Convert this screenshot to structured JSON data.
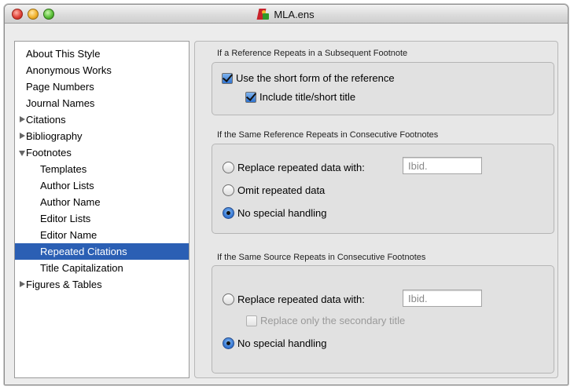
{
  "window": {
    "title": "MLA.ens"
  },
  "sidebar": {
    "items": [
      {
        "label": "About This Style",
        "expander": "none",
        "selected": false
      },
      {
        "label": "Anonymous Works",
        "expander": "none",
        "selected": false
      },
      {
        "label": "Page Numbers",
        "expander": "none",
        "selected": false
      },
      {
        "label": "Journal Names",
        "expander": "none",
        "selected": false
      },
      {
        "label": "Citations",
        "expander": "collapsed",
        "selected": false
      },
      {
        "label": "Bibliography",
        "expander": "collapsed",
        "selected": false
      },
      {
        "label": "Footnotes",
        "expander": "expanded",
        "selected": false
      },
      {
        "label": "Templates",
        "expander": "none",
        "selected": false
      },
      {
        "label": "Author Lists",
        "expander": "none",
        "selected": false
      },
      {
        "label": "Author Name",
        "expander": "none",
        "selected": false
      },
      {
        "label": "Editor Lists",
        "expander": "none",
        "selected": false
      },
      {
        "label": "Editor Name",
        "expander": "none",
        "selected": false
      },
      {
        "label": "Repeated Citations",
        "expander": "none",
        "selected": true
      },
      {
        "label": "Title Capitalization",
        "expander": "none",
        "selected": false
      },
      {
        "label": "Figures & Tables",
        "expander": "collapsed",
        "selected": false
      }
    ]
  },
  "section1": {
    "title": "If a Reference Repeats in a Subsequent Footnote",
    "use_short_form": {
      "label": "Use the short form of the reference",
      "checked": true
    },
    "include_title": {
      "label": "Include title/short title",
      "checked": true
    }
  },
  "section2": {
    "title": "If the Same Reference Repeats in Consecutive Footnotes",
    "replace": {
      "label": "Replace repeated data with:",
      "selected": false
    },
    "replace_input": {
      "value": "Ibid.",
      "placeholder": ""
    },
    "omit": {
      "label": "Omit repeated data",
      "selected": false
    },
    "none": {
      "label": "No special handling",
      "selected": true
    }
  },
  "section3": {
    "title": "If the Same Source Repeats in Consecutive Footnotes",
    "replace": {
      "label": "Replace repeated data with:",
      "selected": false
    },
    "replace_input": {
      "value": "Ibid.",
      "placeholder": ""
    },
    "secondary_only": {
      "label": "Replace only the secondary title",
      "checked": false,
      "enabled": false
    },
    "none": {
      "label": "No special handling",
      "selected": true
    }
  },
  "colors": {
    "selection": "#2b5fb4",
    "checkbox_accent": "#2f73d0"
  }
}
